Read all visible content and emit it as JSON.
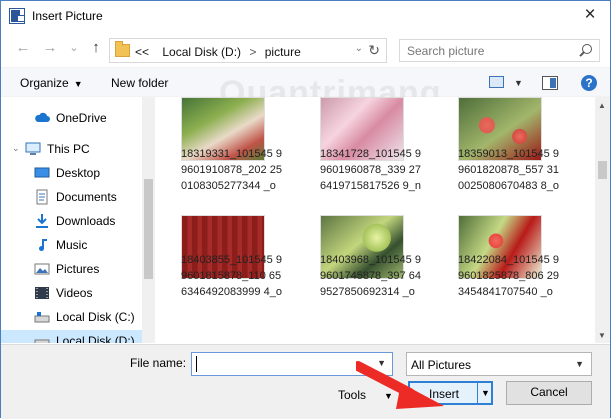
{
  "window": {
    "title": "Insert Picture",
    "close_glyph": "×"
  },
  "navigation": {
    "back_glyph": "←",
    "forward_glyph": "→",
    "recent_glyph": "⌄",
    "up_glyph": "↑",
    "address": {
      "prefix": "<<",
      "items": [
        "Local Disk (D:)",
        "picture"
      ],
      "separator": ">"
    },
    "refresh_glyph": "↻",
    "search": {
      "placeholder": "Search picture"
    }
  },
  "toolbar": {
    "organize_label": "Organize",
    "organize_caret": "▼",
    "new_folder_label": "New folder",
    "view_caret": "▼",
    "help_label": "?"
  },
  "watermark": "Quantrimang",
  "sidebar": {
    "items": [
      {
        "label": "OneDrive",
        "icon": "cloud-icon"
      },
      {
        "label": "This PC",
        "icon": "computer-icon"
      },
      {
        "label": "Desktop",
        "icon": "desktop-icon"
      },
      {
        "label": "Documents",
        "icon": "documents-icon"
      },
      {
        "label": "Downloads",
        "icon": "downloads-icon"
      },
      {
        "label": "Music",
        "icon": "music-icon"
      },
      {
        "label": "Pictures",
        "icon": "pictures-icon"
      },
      {
        "label": "Videos",
        "icon": "videos-icon"
      },
      {
        "label": "Local Disk (C:)",
        "icon": "drive-icon"
      },
      {
        "label": "Local Disk (D:)",
        "icon": "drive-icon"
      }
    ],
    "expander_glyph": "›",
    "expanded_glyph": "⌄"
  },
  "files": [
    {
      "name": "18319331_101545 99601910878_202 250108305277344 _o",
      "image": "red-flowers-icon"
    },
    {
      "name": "18341728_101545 99601960878_339 276419715817526 9_n",
      "image": "pink-blossoms-icon"
    },
    {
      "name": "18359013_101545 99601820878_557 310025080670483 8_o",
      "image": "garden-flowers-icon"
    },
    {
      "name": "18403855_101545 99601815878_110 656346492083999 4_o",
      "image": "red-building-icon"
    },
    {
      "name": "18403968_101545 99601745878_397 649527850692314 _o",
      "image": "tree-icon"
    },
    {
      "name": "18422084_101545 99601825878_806 293454841707540 _o",
      "image": "red-flowers-icon"
    }
  ],
  "bottom": {
    "file_name_label": "File name:",
    "file_name_value": "",
    "dropdown_glyph": "▼",
    "file_type": "All Pictures",
    "tools_label": "Tools",
    "insert_label": "Insert",
    "cancel_label": "Cancel"
  },
  "colors": {
    "accent": "#2f7fd4",
    "selection": "#cce8ff",
    "arrow": "#ec2b26"
  }
}
